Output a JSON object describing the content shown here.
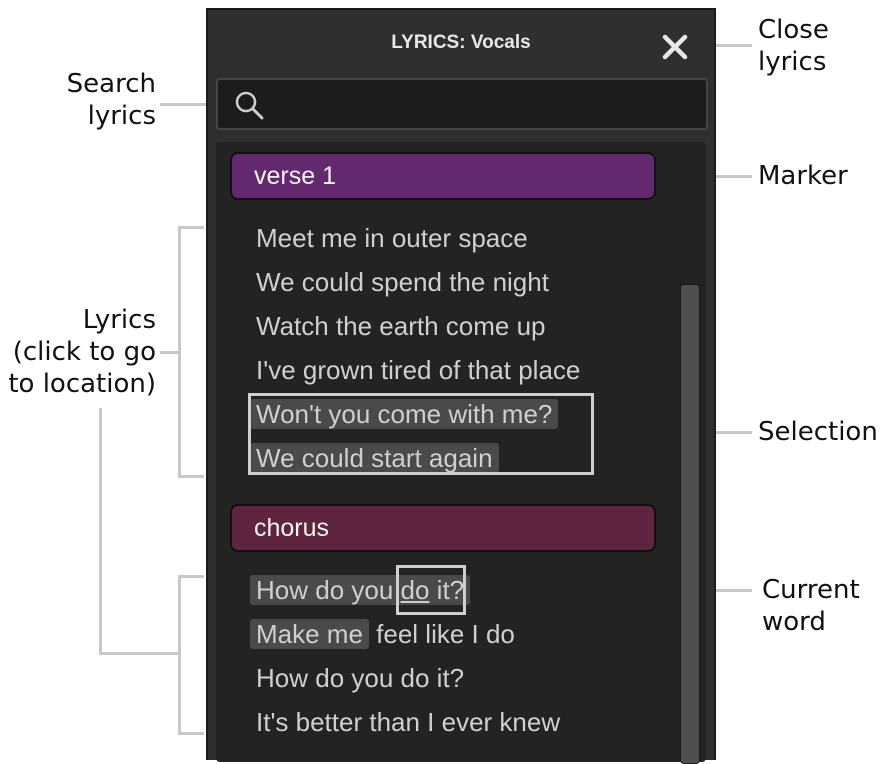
{
  "panel": {
    "title": "LYRICS: Vocals",
    "search_placeholder": "",
    "close_icon": "close-icon",
    "search_icon": "search-icon"
  },
  "markers": [
    {
      "label": "verse 1",
      "color": "#63286e"
    },
    {
      "label": "chorus",
      "color": "#5e2440"
    }
  ],
  "verse_lines": [
    {
      "text": "Meet me in outer space",
      "selected": false
    },
    {
      "text": "We could spend the night",
      "selected": false
    },
    {
      "text": "Watch the earth come up",
      "selected": false
    },
    {
      "text": "I've grown tired of that place",
      "selected": false
    },
    {
      "text": "Won't you come with me?",
      "selected": true
    },
    {
      "text": "We could start again",
      "selected": true
    }
  ],
  "chorus_lines": {
    "line1": {
      "before": "How do you ",
      "current": "do",
      "after": " it?"
    },
    "line2": {
      "highlighted": "Make me",
      "rest": " feel like I do"
    },
    "line3": "How do you do it?",
    "line4": "It's better than I ever knew"
  },
  "callouts": {
    "search": "Search\nlyrics",
    "lyrics": "Lyrics\n(click to go\nto location)",
    "close": "Close\nlyrics",
    "marker": "Marker",
    "selection": "Selection",
    "current_word": "Current\nword"
  }
}
